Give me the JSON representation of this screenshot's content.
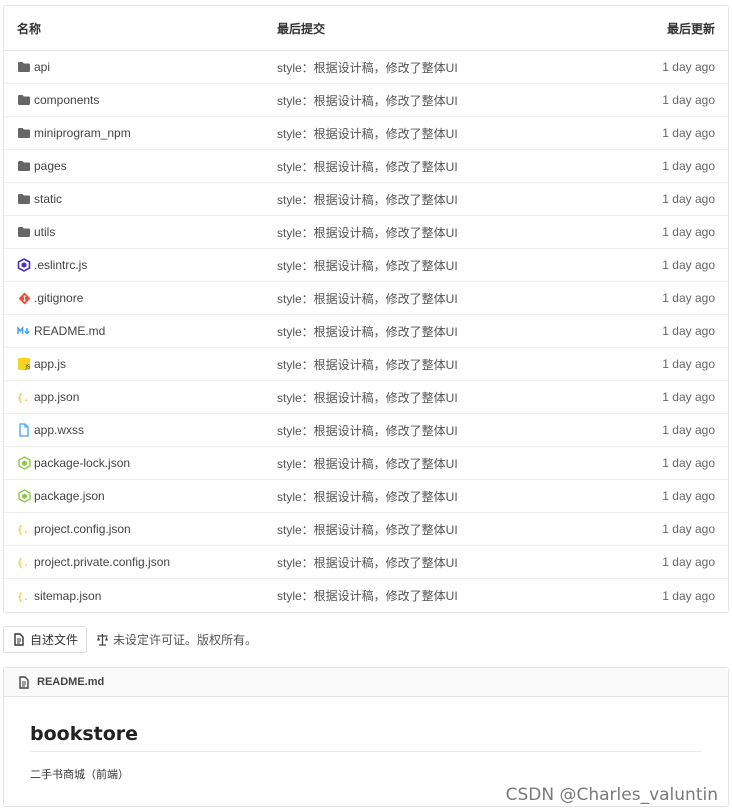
{
  "table": {
    "headers": {
      "name": "名称",
      "commit": "最后提交",
      "date": "最后更新"
    },
    "rows": [
      {
        "name": "api",
        "icon": "folder-icon",
        "commit": "style：根据设计稿，修改了整体UI",
        "date": "1 day ago"
      },
      {
        "name": "components",
        "icon": "folder-icon",
        "commit": "style：根据设计稿，修改了整体UI",
        "date": "1 day ago"
      },
      {
        "name": "miniprogram_npm",
        "icon": "folder-icon",
        "commit": "style：根据设计稿，修改了整体UI",
        "date": "1 day ago"
      },
      {
        "name": "pages",
        "icon": "folder-icon",
        "commit": "style：根据设计稿，修改了整体UI",
        "date": "1 day ago"
      },
      {
        "name": "static",
        "icon": "folder-icon",
        "commit": "style：根据设计稿，修改了整体UI",
        "date": "1 day ago"
      },
      {
        "name": "utils",
        "icon": "folder-icon",
        "commit": "style：根据设计稿，修改了整体UI",
        "date": "1 day ago"
      },
      {
        "name": ".eslintrc.js",
        "icon": "eslint-icon",
        "commit": "style：根据设计稿，修改了整体UI",
        "date": "1 day ago"
      },
      {
        "name": ".gitignore",
        "icon": "git-icon",
        "commit": "style：根据设计稿，修改了整体UI",
        "date": "1 day ago"
      },
      {
        "name": "README.md",
        "icon": "markdown-icon",
        "commit": "style：根据设计稿，修改了整体UI",
        "date": "1 day ago"
      },
      {
        "name": "app.js",
        "icon": "javascript-icon",
        "commit": "style：根据设计稿，修改了整体UI",
        "date": "1 day ago"
      },
      {
        "name": "app.json",
        "icon": "json-icon",
        "commit": "style：根据设计稿，修改了整体UI",
        "date": "1 day ago"
      },
      {
        "name": "app.wxss",
        "icon": "file-icon",
        "commit": "style：根据设计稿，修改了整体UI",
        "date": "1 day ago"
      },
      {
        "name": "package-lock.json",
        "icon": "nodejs-icon",
        "commit": "style：根据设计稿，修改了整体UI",
        "date": "1 day ago"
      },
      {
        "name": "package.json",
        "icon": "nodejs-icon",
        "commit": "style：根据设计稿，修改了整体UI",
        "date": "1 day ago"
      },
      {
        "name": "project.config.json",
        "icon": "json-icon",
        "commit": "style：根据设计稿，修改了整体UI",
        "date": "1 day ago"
      },
      {
        "name": "project.private.config.json",
        "icon": "json-icon",
        "commit": "style：根据设计稿，修改了整体UI",
        "date": "1 day ago"
      },
      {
        "name": "sitemap.json",
        "icon": "json-icon",
        "commit": "style：根据设计稿，修改了整体UI",
        "date": "1 day ago"
      }
    ]
  },
  "footer": {
    "read_button": "自述文件",
    "license_text": "未设定许可证。版权所有。"
  },
  "readme": {
    "filename": "README.md",
    "title": "bookstore",
    "description": "二手书商城（前端）"
  },
  "watermark": "CSDN @Charles_valuntin",
  "colors": {
    "folder": "#666666",
    "eslint": "#4b32c3",
    "git": "#f05033",
    "markdown": "#42a5f5",
    "javascript": "#f5d31f",
    "json": "#f5b400",
    "file": "#42a5f5",
    "nodejs": "#8cc84b"
  }
}
